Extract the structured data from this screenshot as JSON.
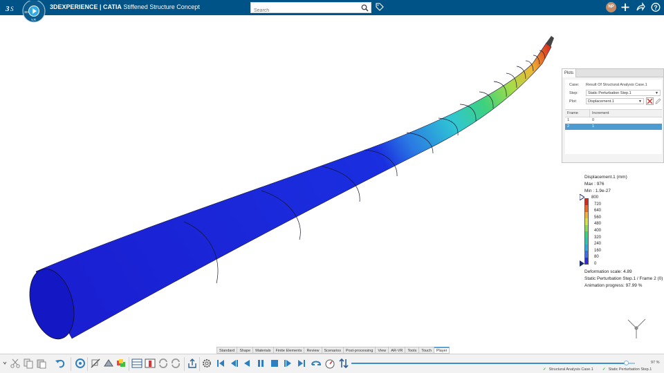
{
  "app": {
    "brand_icon": "3ds-logo-icon",
    "title_prefix": "3DEXPERIENCE | CATIA",
    "title_rest": "Stiffened Structure Concept",
    "compass_label_3d": "3D",
    "compass_label_vr": "V,R"
  },
  "search": {
    "placeholder": "Search"
  },
  "user": {
    "initials": "NP"
  },
  "plots_panel": {
    "tab_label": "Plots",
    "case_label": "Case:",
    "case_value": "Result Of Structural Analysis Case.1",
    "step_label": "Step:",
    "step_value": "Static Perturbation Step.1",
    "plot_label": "Plot:",
    "plot_value": "Displacement.1",
    "columns": [
      "Frame",
      "Increment"
    ],
    "rows": [
      {
        "frame": "1",
        "increment": "0"
      },
      {
        "frame": "2",
        "increment": "1"
      }
    ],
    "selected_row": 1
  },
  "legend": {
    "title": "Displacement.1 (mm)",
    "max": "Max : 976",
    "min": "Min : 1.9e-27",
    "ticks": [
      "800",
      "720",
      "640",
      "560",
      "480",
      "400",
      "320",
      "240",
      "160",
      "80",
      "0"
    ],
    "deformation_scale": "Deformation scale: 4.89",
    "step_frame": "Static Perturbation Step.1 / Frame 2 (0)",
    "animation_progress": "Animation progress: 97.99 %",
    "colors": [
      "#d42b1f",
      "#e96a25",
      "#f2b33a",
      "#d7e24a",
      "#8fd95a",
      "#3fd07a",
      "#2ec7ad",
      "#33a7d8",
      "#3f6fe0",
      "#2c2fd6"
    ]
  },
  "action_tabs": [
    "Standard",
    "Shape",
    "Materials",
    "Finite Elements",
    "Review",
    "Scenarios",
    "Post-processing",
    "View",
    "AR-VR",
    "Tools",
    "Touch",
    "Player"
  ],
  "active_tab": "Player",
  "player": {
    "progress": 0.97,
    "progress_label": "97 %"
  },
  "status": {
    "item1": "Structural Analysis Case.1",
    "item2": "Static Perturbation Step.1"
  }
}
